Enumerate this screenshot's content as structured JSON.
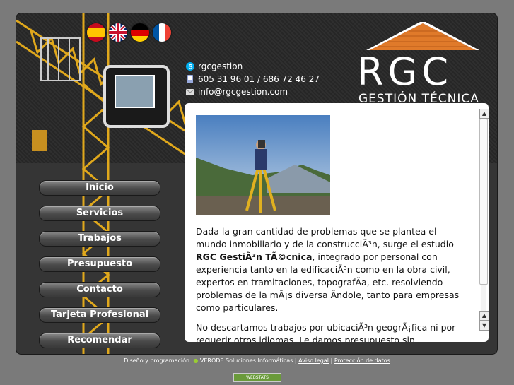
{
  "header": {
    "flags": [
      {
        "name": "spain-flag-icon"
      },
      {
        "name": "uk-flag-icon"
      },
      {
        "name": "germany-flag-icon"
      },
      {
        "name": "france-flag-icon"
      }
    ],
    "contact": {
      "skype": "rgcgestion",
      "phone": "605 31 96 01 / 686 72 46 27",
      "email": "info@rgcgestion.com"
    },
    "logo": {
      "main": "RGC",
      "sub": "GESTIÓN TÉCNICA"
    }
  },
  "menu": {
    "items": [
      "Inicio",
      "Servicios",
      "Trabajos",
      "Presupuesto",
      "Contacto",
      "Tarjeta Profesional",
      "Recomendar"
    ]
  },
  "content": {
    "p1_a": "Dada la gran cantidad de problemas que se plantea el mundo inmobiliario y de la construcciÃ³n, surge el estudio ",
    "p1_bold": "RGC GestiÃ³n TÃ©cnica",
    "p1_b": ", integrado por personal con experiencia tanto en la edificaciÃ³n como en la obra civil, expertos en tramitaciones, topografÃa, etc. resolviendo problemas de la mÃ¡s diversa Ãndole, tanto para empresas como particulares.",
    "p2": "No descartamos trabajos por ubicaciÃ³n geogrÃ¡fica ni por requerir otros idiomas. Le damos presupuesto sin compromiso, estando"
  },
  "footer": {
    "design_label": "Diseño y programación:",
    "company": "VERODE Soluciones Informáticas",
    "legal": "Aviso legal",
    "separator": "|",
    "privacy": "Protección de datos",
    "stats": "WEBSTATS"
  },
  "colors": {
    "accent": "#e07a2a",
    "crane": "#e0a81c"
  }
}
